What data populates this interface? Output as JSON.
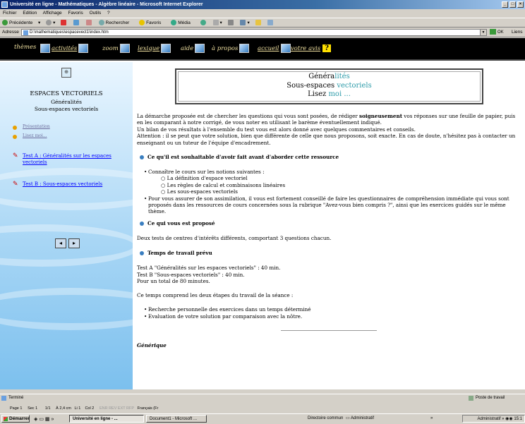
{
  "window": {
    "title": "Université en ligne - Mathématiques - Algèbre linéaire - Microsoft Internet Explorer"
  },
  "menu": [
    "Fichier",
    "Edition",
    "Affichage",
    "Favoris",
    "Outils",
    "?"
  ],
  "toolbar": {
    "back": "Précédente",
    "search": "Rechercher",
    "favorites": "Favoris",
    "media": "Média"
  },
  "address": {
    "label": "Adresse",
    "value": "D:\\mathematiques\\espacevect1\\index.htm",
    "go": "OK",
    "links": "Liens"
  },
  "nav": [
    "thèmes",
    "activités",
    "zoom",
    "lexique",
    "aide",
    "à propos",
    "accueil",
    "votre avis"
  ],
  "sidebar": {
    "title": "ESPACES VECTORIELS",
    "subtitle1": "Généralités",
    "subtitle2": "Sous-espaces vectoriels",
    "links": [
      "Présentation",
      "Lisez moi..."
    ],
    "tests": [
      "Test A : Généralités sur les espaces vectoriels",
      "Test B : Sous-espaces vectoriels"
    ]
  },
  "header": {
    "line1_a": "Généra",
    "line1_b": "lités",
    "line2_a": "Sous-espaces ",
    "line2_b": "vectoriels",
    "line3_a": "Lisez ",
    "line3_b": "moi ..."
  },
  "intro": {
    "p1_a": "La démarche proposée est de chercher les questions qui vous sont posées, de rédiger ",
    "p1_bold": "soigneusement",
    "p1_b": " vos réponses sur une feuille de papier, puis en les comparant à notre corrigé, de vous noter en utilisant le barème éventuellement indiqué.",
    "p2": "Un bilan de vos résultats à l'ensemble du test vous est alors donné avec quelques commentaires et conseils.",
    "p3": "Attention : il se peut que votre solution, bien que différente de celle que nous proposons, soit exacte. En cas de doute, n'hésitez pas à contacter un enseignant ou un tuteur de l'équipe d'encadrement."
  },
  "prereq": {
    "title": "Ce qu'il est souhaitable d'avoir fait avant d'aborder cette ressource",
    "item1": "Connaître le cours sur les notions suivantes :",
    "subs": [
      "La définition d'espace vectoriel",
      "Les règles de calcul et combinaisons linéaires",
      "Les sous-espaces vectoriels"
    ],
    "item2": "Pour vous assurer de son assimilation, il vous est fortement conseillé de faire les questionnaires de compréhension immédiate qui vous sont proposés dans les ressources de cours concernées sous la rubrique \"Avez-vous bien compris ?\", ainsi que les exercices guidés sur le même thème."
  },
  "proposed": {
    "title": "Ce qui vous est proposé",
    "text": "Deux tests de centres d'intérêts différents, comportant 3 questions chacun."
  },
  "time": {
    "title": "Temps de travail prévu",
    "lines": [
      "Test A \"Généralités sur les espaces vectoriels\" : 40 min.",
      "Test B \"Sous-espaces vectoriels\" : 40 min.",
      "Pour un total de 80 minutes."
    ],
    "intro": "Ce temps comprend les deux étapes du travail de la séance :",
    "steps": [
      "Recherche personnelle des exercices dans un temps déterminé",
      "Evaluation de votre solution par comparaison avec la nôtre."
    ]
  },
  "generique": "Générique",
  "status": {
    "left": "Terminé",
    "zone": "Poste de travail"
  },
  "word": {
    "page": "Page 1",
    "sec": "Sec 1",
    "pages": "1/1",
    "pos": "À 2,4 cm",
    "li": "Li 1",
    "col": "Col 2",
    "flags": "ENR  REV  EXT  RFP",
    "lang": "Français (Fr"
  },
  "taskbar": {
    "start": "Démarrer",
    "tasks": [
      "Université en ligne - ...",
      "Document1 - Microsoft ..."
    ],
    "middle": "Directoire commun",
    "middle2": "Administratif",
    "tray_label": "Administratif",
    "clock": "15:1"
  }
}
